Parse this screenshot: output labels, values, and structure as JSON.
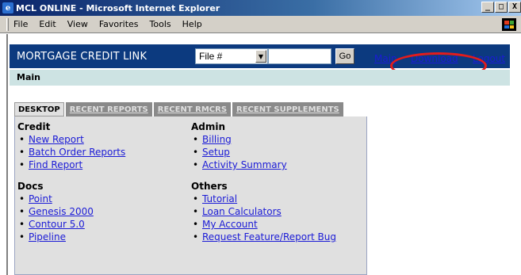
{
  "window": {
    "title": "MCL ONLINE - Microsoft Internet Explorer",
    "buttons": [
      "_",
      "□",
      "X"
    ]
  },
  "menu": [
    "File",
    "Edit",
    "View",
    "Favorites",
    "Tools",
    "Help"
  ],
  "header": {
    "brand": "MORTGAGE CREDIT LINK",
    "select_value": "File #",
    "search_value": "",
    "go_label": "Go",
    "links": [
      "Main",
      "Download",
      "Logout"
    ]
  },
  "subbar": {
    "title": "Main"
  },
  "tabs": [
    {
      "label": "DESKTOP",
      "active": true
    },
    {
      "label": "RECENT REPORTS",
      "active": false
    },
    {
      "label": "RECENT RMCRS",
      "active": false
    },
    {
      "label": "RECENT SUPPLEMENTS",
      "active": false
    }
  ],
  "sections": {
    "credit": {
      "title": "Credit",
      "items": [
        "New Report",
        "Batch Order Reports",
        "Find Report"
      ]
    },
    "admin": {
      "title": "Admin",
      "items": [
        "Billing",
        "Setup",
        "Activity Summary"
      ]
    },
    "docs": {
      "title": "Docs",
      "items": [
        "Point",
        "Genesis 2000",
        "Contour 5.0",
        "Pipeline"
      ]
    },
    "others": {
      "title": "Others",
      "items": [
        "Tutorial",
        "Loan Calculators",
        "My Account",
        "Request Feature/Report Bug"
      ]
    }
  },
  "colors": {
    "header_bg": "#0c3a7f",
    "subbar_bg": "#cde3e3",
    "link": "#1b1bd6",
    "highlight_circle": "#e21c1c"
  }
}
